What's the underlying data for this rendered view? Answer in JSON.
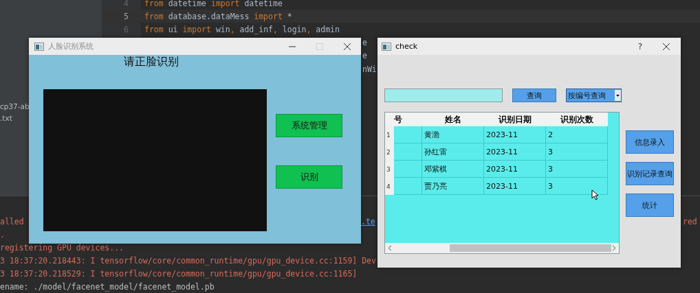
{
  "ide": {
    "project_items": [
      "cp37-ab",
      ".txt"
    ],
    "code_lines": [
      {
        "kind": "full",
        "number": "4",
        "current": false,
        "tokens": [
          {
            "text": "from",
            "kind": "keyword"
          },
          {
            "text": " datetime ",
            "kind": "plain"
          },
          {
            "text": "import",
            "kind": "keyword"
          },
          {
            "text": " datetime",
            "kind": "plain"
          }
        ]
      },
      {
        "kind": "full",
        "number": "5",
        "current": true,
        "tokens": [
          {
            "text": "from",
            "kind": "keyword"
          },
          {
            "text": " database.dataMess ",
            "kind": "plain"
          },
          {
            "text": "import",
            "kind": "keyword"
          },
          {
            "text": " *",
            "kind": "plain"
          }
        ]
      },
      {
        "kind": "full",
        "number": "6",
        "current": false,
        "tokens": [
          {
            "text": "from",
            "kind": "keyword"
          },
          {
            "text": " ui ",
            "kind": "plain"
          },
          {
            "text": "import",
            "kind": "keyword"
          },
          {
            "text": " win",
            "kind": "plain"
          },
          {
            "text": ",",
            "kind": "keyword"
          },
          {
            "text": " add_inf",
            "kind": "plain"
          },
          {
            "text": ",",
            "kind": "keyword"
          },
          {
            "text": " login",
            "kind": "plain"
          },
          {
            "text": ",",
            "kind": "keyword"
          },
          {
            "text": " admin",
            "kind": "plain"
          }
        ]
      },
      {
        "kind": "fragment",
        "tokens": [
          {
            "text": "e",
            "kind": "plain"
          }
        ]
      },
      {
        "kind": "fragment",
        "tokens": [
          {
            "text": "e",
            "kind": "plain"
          }
        ]
      },
      {
        "kind": "fragment",
        "tokens": [
          {
            "text": "nWi",
            "kind": "plain"
          }
        ]
      }
    ],
    "console_lines": [
      {
        "left": {
          "text": "alled",
          "kind": "error"
        },
        "middle": {
          "text": ".te",
          "kind": "link"
        },
        "right": {
          "text": "red",
          "kind": "error"
        }
      },
      {
        "left": {
          "text": ".",
          "kind": "error"
        }
      },
      {
        "left": {
          "text": "registering GPU devices...",
          "kind": "error"
        }
      },
      {
        "left": {
          "text": "3 18:37:20.218443: I tensorflow/core/common_runtime/gpu/gpu_device.cc:1159] Dev",
          "kind": "error"
        }
      },
      {
        "left": {
          "text": "3 18:37:20.218529: I tensorflow/core/common_runtime/gpu/gpu_device.cc:1165]",
          "kind": "error"
        }
      },
      {
        "left": {
          "text": "ename: ./model/facenet_model/facenet_model.pb",
          "kind": "plain"
        }
      }
    ]
  },
  "face_window": {
    "title": "人脸识别系统",
    "active": false,
    "heading": "请正脸识别",
    "buttons": [
      "系统管理",
      "识别"
    ]
  },
  "check_window": {
    "title": "check",
    "active": true,
    "help_button": "?",
    "search_button": "查询",
    "filter": "按编号查询",
    "table": {
      "columns": [
        "号",
        "姓名",
        "识别日期",
        "识别次数"
      ],
      "rows": [
        {
          "number": "1",
          "cells": [
            "",
            "黄渤",
            "2023-11",
            "2"
          ]
        },
        {
          "number": "2",
          "cells": [
            "",
            "孙红雷",
            "2023-11",
            "3"
          ]
        },
        {
          "number": "3",
          "cells": [
            "",
            "邓紫棋",
            "2023-11",
            "3"
          ]
        },
        {
          "number": "4",
          "cells": [
            "",
            "贾乃亮",
            "2023-11",
            "3"
          ]
        }
      ]
    },
    "side_buttons": [
      "信息录入",
      "识别记录查询",
      "统计"
    ]
  }
}
